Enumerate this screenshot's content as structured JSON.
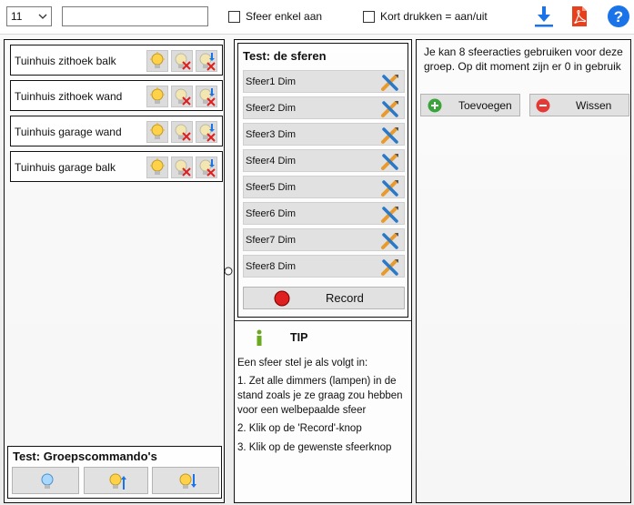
{
  "toolbar": {
    "select_value": "11",
    "textbox_value": "",
    "checkbox_sfeer_label": "Sfeer enkel aan",
    "checkbox_kort_label": "Kort drukken = aan/uit",
    "icons": [
      "download-icon",
      "pdf-icon",
      "help-icon"
    ]
  },
  "groups": [
    {
      "label": "Tuinhuis zithoek balk"
    },
    {
      "label": "Tuinhuis zithoek wand"
    },
    {
      "label": "Tuinhuis garage wand"
    },
    {
      "label": "Tuinhuis garage balk"
    }
  ],
  "groupcommands": {
    "title": "Test: Groepscommando's"
  },
  "sferen": {
    "title": "Test: de sferen",
    "items": [
      "Sfeer1 Dim",
      "Sfeer2 Dim",
      "Sfeer3 Dim",
      "Sfeer4 Dim",
      "Sfeer5 Dim",
      "Sfeer6 Dim",
      "Sfeer7 Dim",
      "Sfeer8 Dim"
    ],
    "record_label": "Record"
  },
  "tip": {
    "title": "TIP",
    "intro": "Een sfeer stel je als volgt in:",
    "step1": "1. Zet alle dimmers (lampen) in de stand zoals je ze graag zou hebben voor een welbepaalde sfeer",
    "step2": "2. Klik op de 'Record'-knop",
    "step3": "3. Klik op de gewenste sfeerknop"
  },
  "right": {
    "info": "Je kan 8 sfeeracties gebruiken voor deze groep. Op dit moment zijn er 0 in gebruik",
    "add_label": "Toevoegen",
    "delete_label": "Wissen"
  },
  "colors": {
    "accent_blue": "#1a73e8",
    "pdf_red": "#e8401c",
    "record_red": "#e02020",
    "add_green": "#3aa43a",
    "delete_red": "#e53935"
  }
}
